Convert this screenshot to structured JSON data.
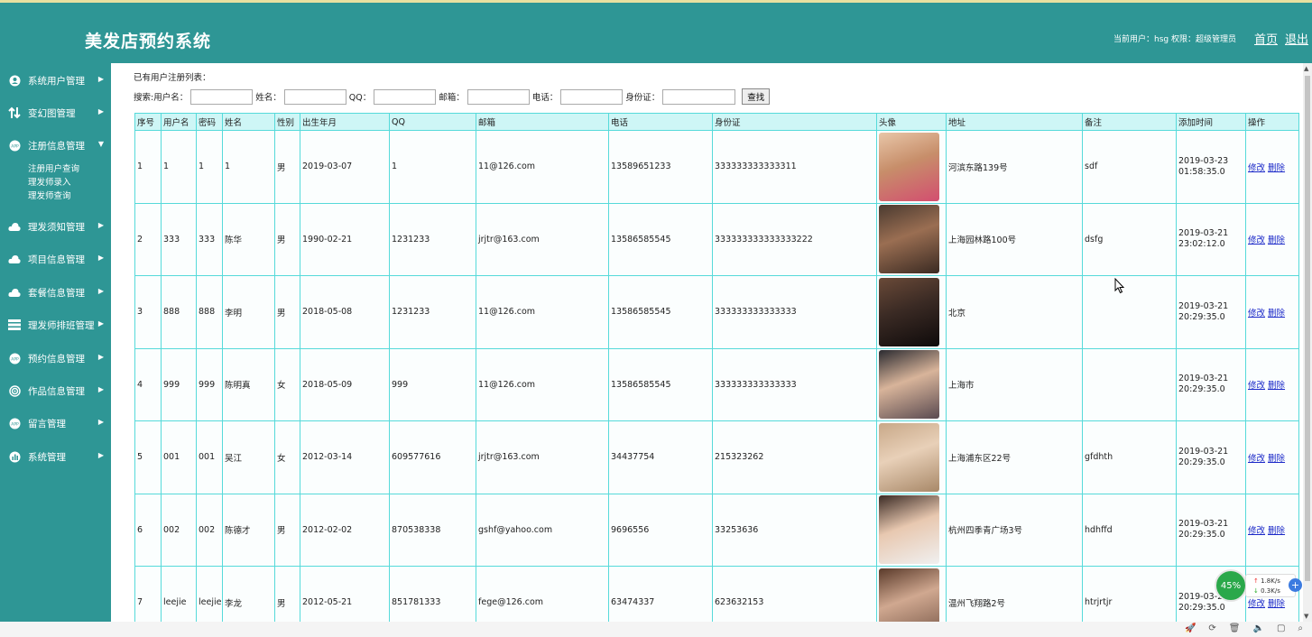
{
  "app": {
    "title": "美发店预约系统",
    "user_info": "当前用户：hsg 权限：超级管理员",
    "home_link": "首页",
    "logout_link": "退出"
  },
  "sidebar": {
    "items": [
      {
        "label": "系统用户管理",
        "icon": "user-circle-icon"
      },
      {
        "label": "变幻图管理",
        "icon": "swap-arrows-icon"
      },
      {
        "label": "注册信息管理",
        "icon": "app-badge-icon",
        "expanded": true
      },
      {
        "label": "理发须知管理",
        "icon": "cloud-icon"
      },
      {
        "label": "项目信息管理",
        "icon": "cloud-icon"
      },
      {
        "label": "套餐信息管理",
        "icon": "cloud-icon"
      },
      {
        "label": "理发师排班管理",
        "icon": "list-icon"
      },
      {
        "label": "预约信息管理",
        "icon": "app-badge-icon"
      },
      {
        "label": "作品信息管理",
        "icon": "target-icon"
      },
      {
        "label": "留言管理",
        "icon": "app-badge-icon"
      },
      {
        "label": "系统管理",
        "icon": "chart-icon"
      }
    ],
    "submenu": [
      "注册用户查询",
      "理发师录入",
      "理发师查询"
    ]
  },
  "list": {
    "title": "已有用户注册列表：",
    "search": {
      "prefix": "搜索:",
      "username_label": "用户名：",
      "name_label": "姓名：",
      "qq_label": "QQ：",
      "email_label": "邮箱：",
      "phone_label": "电话：",
      "idcard_label": "身份证：",
      "button": "查找"
    },
    "columns": [
      "序号",
      "用户名",
      "密码",
      "姓名",
      "性别",
      "出生年月",
      "QQ",
      "邮箱",
      "电话",
      "身份证",
      "头像",
      "地址",
      "备注",
      "添加时间",
      "操作"
    ],
    "edit_label": "修改",
    "delete_label": "删除",
    "rows": [
      {
        "no": "1",
        "username": "1",
        "password": "1",
        "name": "1",
        "gender": "男",
        "birth": "2019-03-07",
        "qq": "1",
        "email": "11@126.com",
        "phone": "13589651233",
        "idcard": "333333333333311",
        "address": "河滨东路139号",
        "note": "sdf",
        "date": "2019-03-23",
        "time": "01:58:35.0"
      },
      {
        "no": "2",
        "username": "333",
        "password": "333",
        "name": "陈华",
        "gender": "男",
        "birth": "1990-02-21",
        "qq": "1231233",
        "email": "jrjtr@163.com",
        "phone": "13586585545",
        "idcard": "333333333333333222",
        "address": "上海园林路100号",
        "note": "dsfg",
        "date": "2019-03-21",
        "time": "23:02:12.0"
      },
      {
        "no": "3",
        "username": "888",
        "password": "888",
        "name": "李明",
        "gender": "男",
        "birth": "2018-05-08",
        "qq": "1231233",
        "email": "11@126.com",
        "phone": "13586585545",
        "idcard": "333333333333333",
        "address": "北京",
        "note": "",
        "date": "2019-03-21",
        "time": "20:29:35.0"
      },
      {
        "no": "4",
        "username": "999",
        "password": "999",
        "name": "陈明真",
        "gender": "女",
        "birth": "2018-05-09",
        "qq": "999",
        "email": "11@126.com",
        "phone": "13586585545",
        "idcard": "333333333333333",
        "address": "上海市",
        "note": "",
        "date": "2019-03-21",
        "time": "20:29:35.0"
      },
      {
        "no": "5",
        "username": "001",
        "password": "001",
        "name": "吴江",
        "gender": "女",
        "birth": "2012-03-14",
        "qq": "609577616",
        "email": "jrjtr@163.com",
        "phone": "34437754",
        "idcard": "215323262",
        "address": "上海浦东区22号",
        "note": "gfdhth",
        "date": "2019-03-21",
        "time": "20:29:35.0"
      },
      {
        "no": "6",
        "username": "002",
        "password": "002",
        "name": "陈德才",
        "gender": "男",
        "birth": "2012-02-02",
        "qq": "870538338",
        "email": "gshf@yahoo.com",
        "phone": "9696556",
        "idcard": "33253636",
        "address": "杭州四季青广场3号",
        "note": "hdhffd",
        "date": "2019-03-21",
        "time": "20:29:35.0"
      },
      {
        "no": "7",
        "username": "leejie",
        "password": "leejie",
        "name": "李龙",
        "gender": "男",
        "birth": "2012-05-21",
        "qq": "851781333",
        "email": "fege@126.com",
        "phone": "63474337",
        "idcard": "623632153",
        "address": "温州飞翔路2号",
        "note": "htrjrtjr",
        "date": "2019-03-21",
        "time": "20:29:35.0"
      }
    ]
  },
  "speed_widget": {
    "percent": "45%",
    "upload": "1.8K/s",
    "download": "0.3K/s"
  },
  "colors": {
    "header": "#2e9695",
    "table_border": "#56dada",
    "table_header": "#cef6f6",
    "link": "#1a28c8"
  }
}
